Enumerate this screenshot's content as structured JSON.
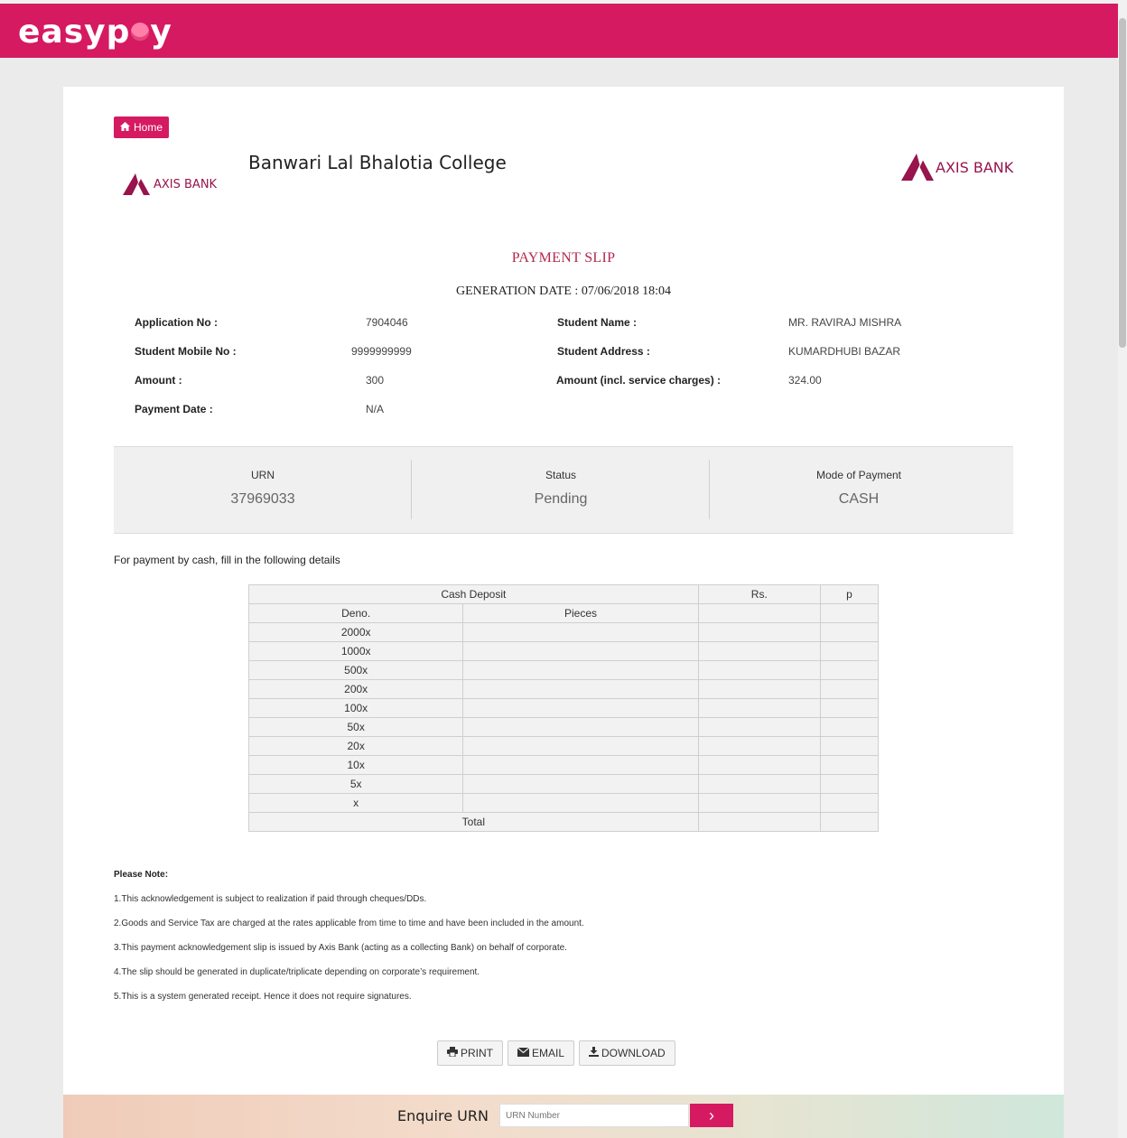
{
  "header": {
    "logo": "easypay",
    "brand_color": "#d51a62"
  },
  "nav": {
    "home_label": "Home"
  },
  "college_name": "Banwari Lal Bhalotia College",
  "bank_name": "AXIS BANK",
  "bank_color": "#97144d",
  "slip": {
    "title": "PAYMENT SLIP",
    "generation_date": "GENERATION DATE : 07/06/2018 18:04"
  },
  "details": {
    "application_no": {
      "label": "Application No :",
      "value": "7904046"
    },
    "student_name": {
      "label": "Student Name :",
      "value": "MR. RAVIRAJ MISHRA"
    },
    "mobile_no": {
      "label": "Student Mobile No :",
      "value": "9999999999"
    },
    "address": {
      "label": "Student Address :",
      "value": "KUMARDHUBI BAZAR"
    },
    "amount": {
      "label": "Amount :",
      "value": "300"
    },
    "amount_incl": {
      "label": "Amount (incl. service charges) :",
      "value": "324.00"
    },
    "payment_date": {
      "label": "Payment Date :",
      "value": "N/A"
    }
  },
  "summary": {
    "urn": {
      "label": "URN",
      "value": "37969033"
    },
    "status": {
      "label": "Status",
      "value": "Pending"
    },
    "mode": {
      "label": "Mode of Payment",
      "value": "CASH"
    }
  },
  "cash_note": "For payment by cash, fill in the following details",
  "deposit": {
    "header": "Cash Deposit",
    "rs": "Rs.",
    "p": "p",
    "deno": "Deno.",
    "pieces": "Pieces",
    "rows": [
      "2000x",
      "1000x",
      "500x",
      "200x",
      "100x",
      "50x",
      "20x",
      "10x",
      "5x",
      "x"
    ],
    "total": "Total"
  },
  "notes": {
    "title": "Please Note:",
    "items": [
      "1.This acknowledgement is subject to realization if paid through cheques/DDs.",
      "2.Goods and Service Tax are charged at the rates applicable from time to time and have been included in the amount.",
      "3.This payment acknowledgement slip is issued by Axis Bank (acting as a collecting Bank) on behalf of corporate.",
      "4.The slip should be generated in duplicate/triplicate depending on corporate’s requirement.",
      "5.This is a system generated receipt. Hence it does not require signatures."
    ]
  },
  "actions": {
    "print": "PRINT",
    "email": "EMAIL",
    "download": "DOWNLOAD"
  },
  "enquire": {
    "label": "Enquire URN",
    "placeholder": "URN Number"
  }
}
